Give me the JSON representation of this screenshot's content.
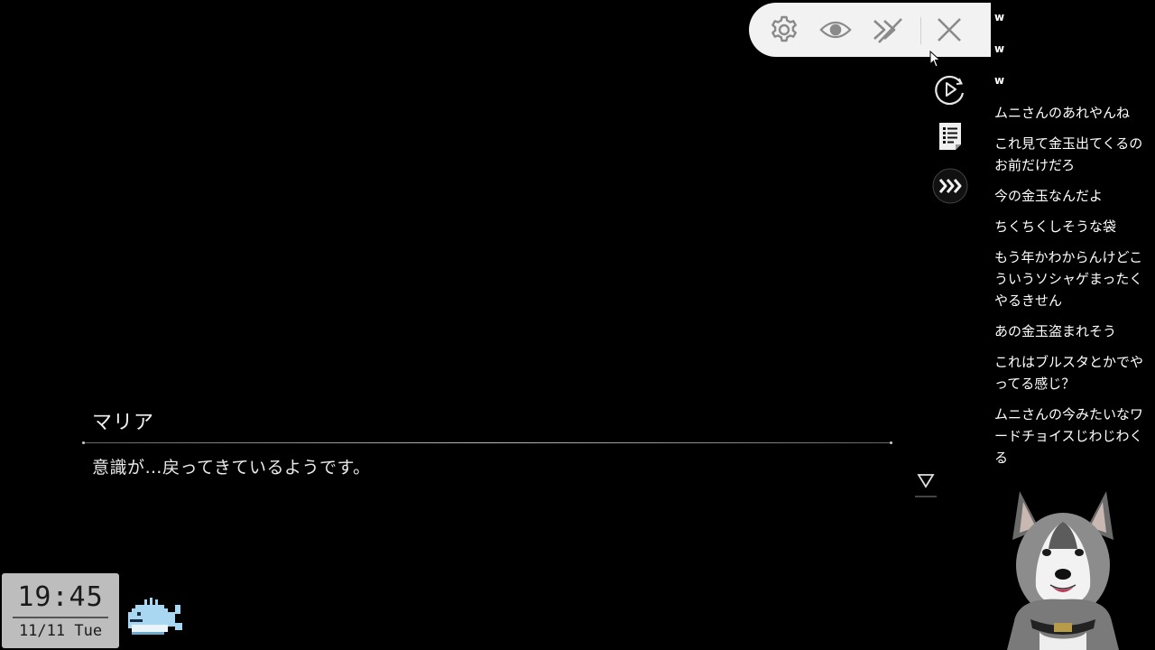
{
  "toolbar": {
    "settings_icon": "gear-icon",
    "view_icon": "eye-icon",
    "skip_icon": "skip-forward-icon",
    "close_icon": "close-icon"
  },
  "side_controls": {
    "auto_icon": "play-circle-icon",
    "log_icon": "backlog-icon",
    "fast_forward_icon": "fast-forward-icon"
  },
  "dialogue": {
    "speaker": "マリア",
    "text": "意識が…戻ってきているようです。"
  },
  "comments": [
    "w",
    "w",
    "w",
    "ムニさんのあれやんね",
    "これ見て金玉出てくるのお前だけだろ",
    "今の金玉なんだよ",
    "ちくちくしそうな袋",
    "もう年かわからんけどこういうソシャゲまったくやるきせん",
    "あの金玉盗まれそう",
    "これはブルスタとかでやってる感じ？",
    "ムニさんの今みたいなワードチョイスじわじわくる"
  ],
  "clock": {
    "time": "19:45",
    "date": "11/11 Tue"
  },
  "colors": {
    "background": "#000000",
    "menu_bg": "#f2f2f2",
    "icon_gray": "#8a8a8a",
    "clock_bg": "#bdbdbd"
  }
}
